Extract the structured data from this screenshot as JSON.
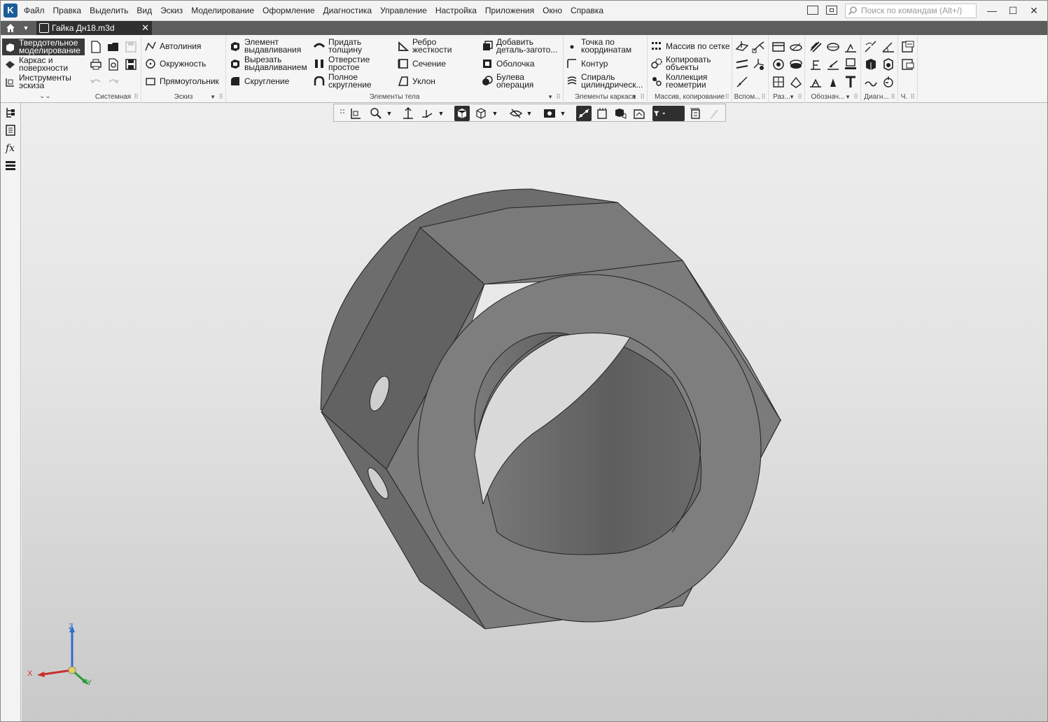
{
  "app": {
    "logo": "K",
    "menu": [
      "Файл",
      "Правка",
      "Выделить",
      "Вид",
      "Эскиз",
      "Моделирование",
      "Оформление",
      "Диагностика",
      "Управление",
      "Настройка",
      "Приложения",
      "Окно",
      "Справка"
    ],
    "search_placeholder": "Поиск по командам (Alt+/)",
    "window_controls": {
      "minimize": "—",
      "maximize": "☐",
      "close": "✕"
    }
  },
  "tabs": {
    "home_icon": "home-icon",
    "document_tab": "Гайка Дн18.m3d",
    "close": "✕"
  },
  "ribbon": {
    "modes": [
      {
        "label": "Твердотельное моделирование",
        "active": true
      },
      {
        "label": "Каркас и поверхности",
        "active": false
      },
      {
        "label": "Инструменты эскиза",
        "active": false
      }
    ],
    "groups": {
      "system": "Системная",
      "sketch": "Эскиз",
      "body_elements": "Элементы тела",
      "frame_elements": "Элементы каркаса",
      "array_copy": "Массив, копирование",
      "auxiliary": "Вспом...",
      "dimensions": "Раз...",
      "designations": "Обознач...",
      "diagnostics": "Диагн...",
      "part": "Ч."
    },
    "sketch_items": [
      "Автолиния",
      "Окружность",
      "Прямоугольник"
    ],
    "body_items": {
      "extrude": "Элемент выдавливания",
      "cut_extrude": "Вырезать выдавливанием",
      "fillet": "Скругление",
      "thicken": "Придать толщину",
      "hole": "Отверстие простое",
      "full_fillet": "Полное скругление",
      "rib": "Ребро жесткости",
      "section": "Сечение",
      "draft": "Уклон",
      "add_blank": "Добавить деталь-загото...",
      "shell": "Оболочка",
      "boolean": "Булева операция"
    },
    "frame_items": {
      "point": "Точка по координатам",
      "contour": "Контур",
      "spiral": "Спираль цилиндрическ..."
    },
    "array_items": {
      "grid_array": "Массив по сетке",
      "copy_objects": "Копировать объекты",
      "collection": "Коллекция геометрии"
    }
  },
  "viewport": {
    "axes": {
      "x": "X",
      "y": "Y",
      "z": "Z"
    },
    "colors": {
      "model": "#747474",
      "background_top": "#eeeeee",
      "background_bottom": "#c9c9c9"
    }
  }
}
